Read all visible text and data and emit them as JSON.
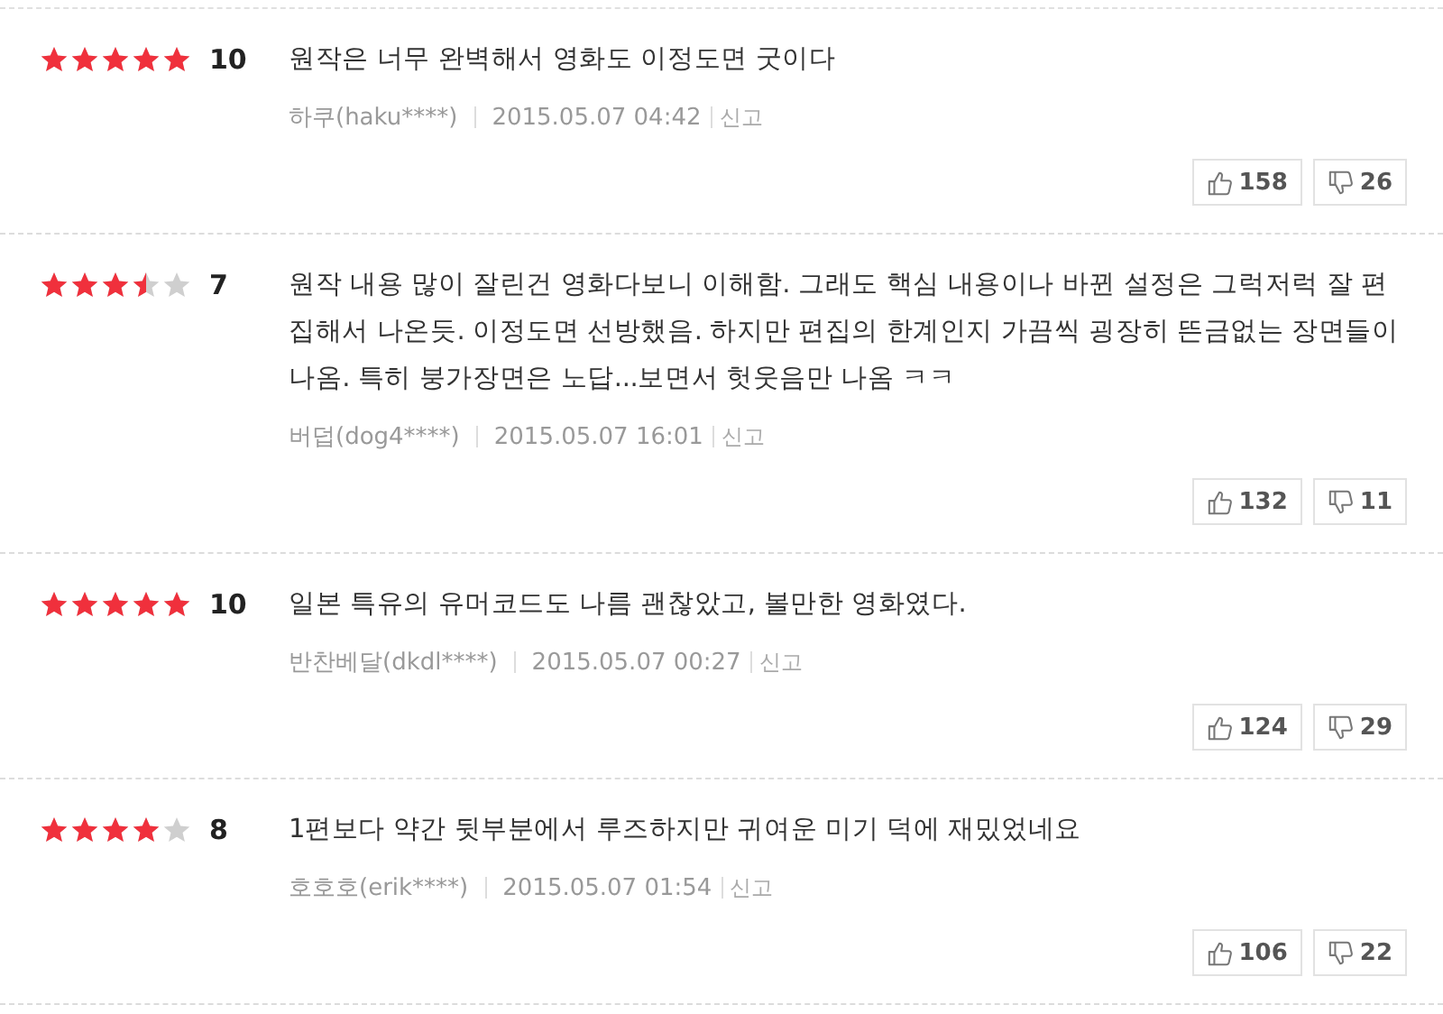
{
  "reviews": [
    {
      "stars": 5,
      "score": "10",
      "text": "원작은 너무 완벽해서 영화도 이정도면 굿이다",
      "author": "하쿠(haku****)",
      "date": "2015.05.07 04:42",
      "report": "신고",
      "likes": "158",
      "dislikes": "26"
    },
    {
      "stars": 3.5,
      "score": "7",
      "text": "원작 내용 많이 잘린건 영화다보니 이해함. 그래도 핵심 내용이나 바뀐 설정은 그럭저럭 잘 편집해서 나온듯. 이정도면 선방했음. 하지만 편집의 한계인지 가끔씩 굉장히 뜬금없는 장면들이 나옴. 특히 붕가장면은 노답...보면서 헛웃음만 나옴 ㅋㅋ",
      "author": "버덥(dog4****)",
      "date": "2015.05.07 16:01",
      "report": "신고",
      "likes": "132",
      "dislikes": "11"
    },
    {
      "stars": 5,
      "score": "10",
      "text": "일본 특유의 유머코드도 나름 괜찮았고, 볼만한 영화였다.",
      "author": "반찬베달(dkdl****)",
      "date": "2015.05.07 00:27",
      "report": "신고",
      "likes": "124",
      "dislikes": "29"
    },
    {
      "stars": 4,
      "score": "8",
      "text": "1편보다 약간 뒷부분에서 루즈하지만 귀여운 미기 덕에 재밌었네요",
      "author": "호호호(erik****)",
      "date": "2015.05.07 01:54",
      "report": "신고",
      "likes": "106",
      "dislikes": "22"
    }
  ]
}
